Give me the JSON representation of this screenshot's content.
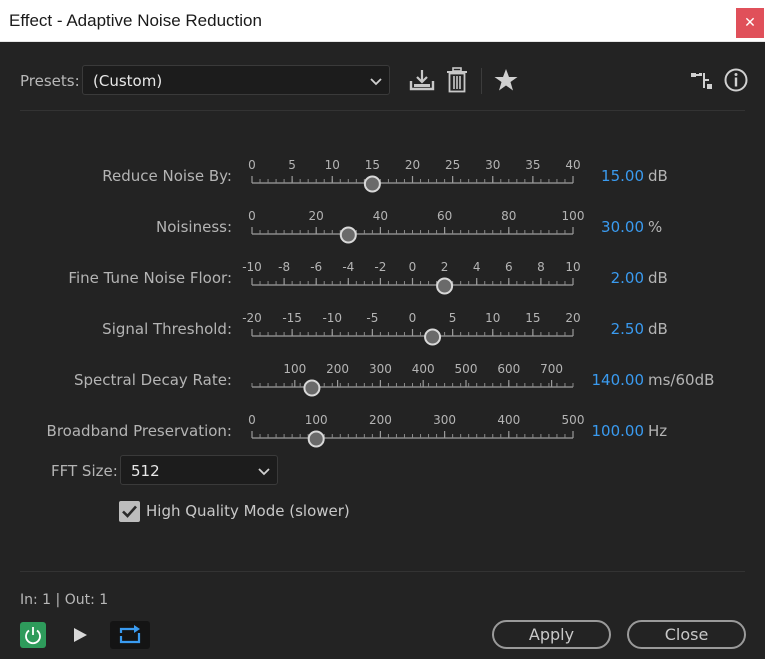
{
  "window": {
    "title": "Effect - Adaptive Noise Reduction",
    "close_glyph": "✕"
  },
  "presets": {
    "label": "Presets:",
    "value": "(Custom)"
  },
  "toolbar": {
    "icons": [
      "save-preset-icon",
      "delete-preset-icon",
      "favorite-star-icon",
      "routing-icon",
      "info-icon"
    ]
  },
  "params": [
    {
      "label": "Reduce Noise By:",
      "value": "15.00",
      "unit": "dB",
      "min": 0,
      "max": 40,
      "current": 15,
      "ticks": [
        "0",
        "5",
        "10",
        "15",
        "20",
        "25",
        "30",
        "35",
        "40"
      ]
    },
    {
      "label": "Noisiness:",
      "value": "30.00",
      "unit": "%",
      "min": 0,
      "max": 100,
      "current": 30,
      "ticks": [
        "0",
        "20",
        "40",
        "60",
        "80",
        "100"
      ]
    },
    {
      "label": "Fine Tune Noise Floor:",
      "value": "2.00",
      "unit": "dB",
      "min": -10,
      "max": 10,
      "current": 2,
      "ticks": [
        "-10",
        "-8",
        "-6",
        "-4",
        "-2",
        "0",
        "2",
        "4",
        "6",
        "8",
        "10"
      ]
    },
    {
      "label": "Signal Threshold:",
      "value": "2.50",
      "unit": "dB",
      "min": -20,
      "max": 20,
      "current": 2.5,
      "ticks": [
        "-20",
        "-15",
        "-10",
        "-5",
        "0",
        "5",
        "10",
        "15",
        "20"
      ]
    },
    {
      "label": "Spectral Decay Rate:",
      "value": "140.00",
      "unit": "ms/60dB",
      "min": 0,
      "max": 750,
      "current": 140,
      "ticks": [
        "100",
        "200",
        "300",
        "400",
        "500",
        "600",
        "700"
      ],
      "tick_values": [
        100,
        200,
        300,
        400,
        500,
        600,
        700
      ]
    },
    {
      "label": "Broadband Preservation:",
      "value": "100.00",
      "unit": "Hz",
      "min": 0,
      "max": 500,
      "current": 100,
      "ticks": [
        "0",
        "100",
        "200",
        "300",
        "400",
        "500"
      ]
    }
  ],
  "fft": {
    "label": "FFT Size:",
    "value": "512"
  },
  "quality": {
    "label": "High Quality Mode (slower)",
    "checked": true
  },
  "io": {
    "text": "In: 1 | Out: 1"
  },
  "buttons": {
    "apply": "Apply",
    "close": "Close"
  },
  "colors": {
    "accent": "#3a9bf0",
    "power": "#2e9b5b",
    "background": "#232323"
  }
}
